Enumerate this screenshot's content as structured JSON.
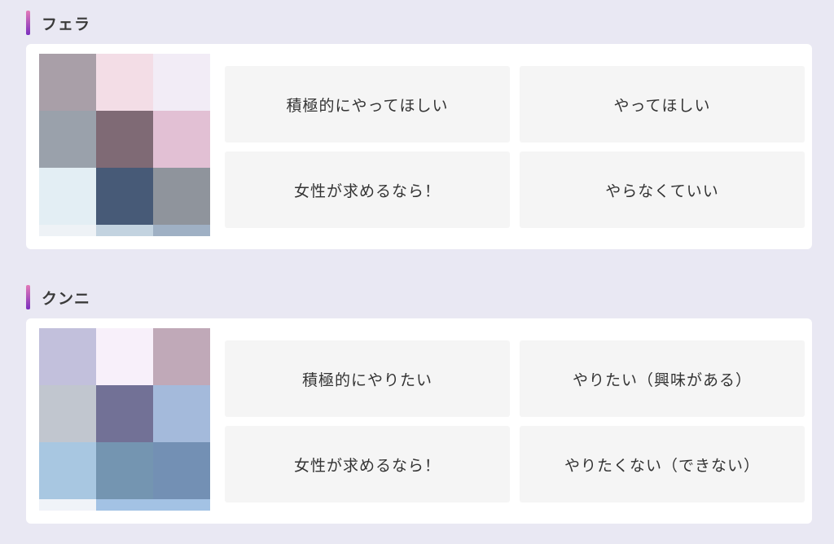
{
  "sections": [
    {
      "title": "フェラ",
      "options": [
        "積極的にやってほしい",
        "やってほしい",
        "女性が求めるなら！",
        "やらなくていい"
      ],
      "mosaic_colors": [
        "#a99fa8",
        "#f3dde6",
        "#f2ecf6",
        "#9aa1ab",
        "#7f6a75",
        "#e2c0d4",
        "#e3eef4",
        "#475a77",
        "#8f949c",
        "#eef2f6",
        "#c3d3e0",
        "#9fb0c4"
      ]
    },
    {
      "title": "クンニ",
      "options": [
        "積極的にやりたい",
        "やりたい（興味がある）",
        "女性が求めるなら！",
        "やりたくない（できない）"
      ],
      "mosaic_colors": [
        "#c2c0dc",
        "#f8f0fa",
        "#c0a9b8",
        "#c1c6cf",
        "#727196",
        "#a4badb",
        "#a8c7e1",
        "#7495b1",
        "#7390b4",
        "#f0f3f8",
        "#a3c2e4",
        "#a3c2e4"
      ]
    }
  ],
  "colors": {
    "background": "#e9e8f3",
    "card": "#ffffff",
    "option": "#f5f5f5",
    "accent_top": "#e37ab8",
    "accent_bottom": "#7b2fbe"
  }
}
